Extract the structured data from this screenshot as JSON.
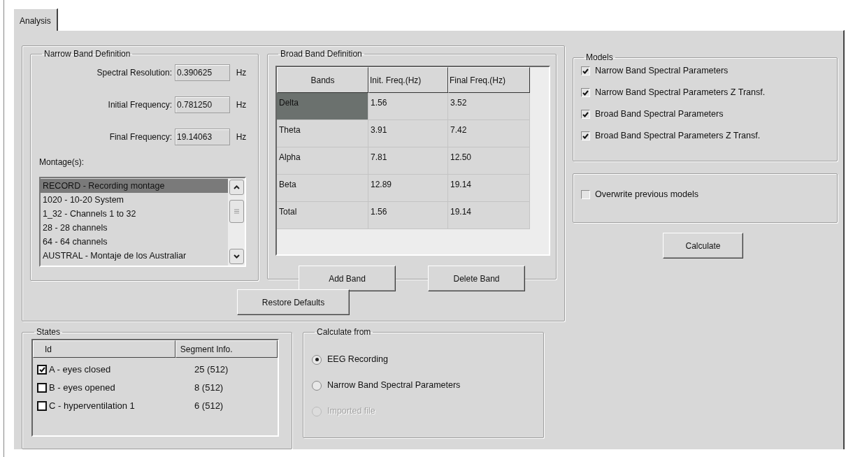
{
  "tabs": [
    {
      "label": "Analysis",
      "selected": true
    }
  ],
  "narrow_band": {
    "title": "Narrow Band Definition",
    "fields": [
      {
        "label": "Spectral Resolution:",
        "value": "0.390625",
        "unit": "Hz"
      },
      {
        "label": "Initial Frequency:",
        "value": "0.781250",
        "unit": "Hz"
      },
      {
        "label": "Final Frequency:",
        "value": "19.14063",
        "unit": "Hz"
      }
    ],
    "montages_label": "Montage(s):",
    "montages": [
      {
        "label": "RECORD - Recording montage",
        "selected": true
      },
      {
        "label": "1020 - 10-20 System",
        "selected": false
      },
      {
        "label": "1_32 - Channels 1 to 32",
        "selected": false
      },
      {
        "label": "28 - 28 channels",
        "selected": false
      },
      {
        "label": "64 - 64 channels",
        "selected": false
      },
      {
        "label": "AUSTRAL - Montaje de los Australiar",
        "selected": false
      }
    ]
  },
  "broad_band": {
    "title": "Broad Band Definition",
    "columns": [
      "Bands",
      "Init. Freq.(Hz)",
      "Final Freq.(Hz)"
    ],
    "rows": [
      {
        "cells": [
          "Delta",
          "1.56",
          "3.52"
        ],
        "selected": true
      },
      {
        "cells": [
          "Theta",
          "3.91",
          "7.42"
        ],
        "selected": false
      },
      {
        "cells": [
          "Alpha",
          "7.81",
          "12.50"
        ],
        "selected": false
      },
      {
        "cells": [
          "Beta",
          "12.89",
          "19.14"
        ],
        "selected": false
      },
      {
        "cells": [
          "Total",
          "1.56",
          "19.14"
        ],
        "selected": false
      }
    ],
    "buttons": [
      "Add Band",
      "Delete Band"
    ]
  },
  "restore_button": "Restore Defaults",
  "states": {
    "title": "States",
    "columns": [
      "Id",
      "Segment Info."
    ],
    "rows": [
      {
        "id": "A - eyes closed",
        "info": "25 (512)",
        "checked": true
      },
      {
        "id": "B - eyes opened",
        "info": "8 (512)",
        "checked": false
      },
      {
        "id": "C - hyperventilation 1",
        "info": "6 (512)",
        "checked": false
      }
    ]
  },
  "calculate_from": {
    "title": "Calculate from",
    "options": [
      {
        "label": "EEG Recording",
        "selected": true,
        "disabled": false
      },
      {
        "label": "Narrow Band Spectral Parameters",
        "selected": false,
        "disabled": false
      },
      {
        "label": "Imported file",
        "selected": false,
        "disabled": true
      }
    ]
  },
  "models": {
    "title": "Models",
    "items": [
      {
        "label": "Narrow Band Spectral Parameters",
        "checked": true
      },
      {
        "label": "Narrow Band Spectral Parameters Z Transf.",
        "checked": true
      },
      {
        "label": "Broad Band Spectral Parameters",
        "checked": true
      },
      {
        "label": "Broad Band Spectral Parameters Z Transf.",
        "checked": true
      }
    ]
  },
  "overwrite": {
    "label": "Overwrite previous models",
    "checked": false
  },
  "calculate_button": "Calculate"
}
